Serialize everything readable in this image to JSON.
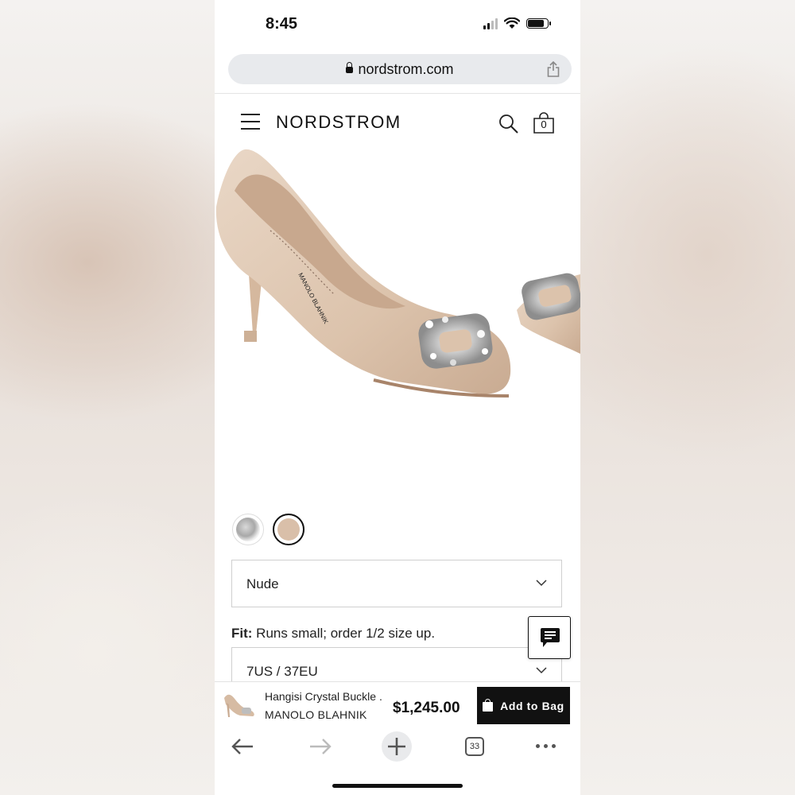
{
  "status_bar": {
    "time": "8:45",
    "icons": [
      "signal-icon",
      "wifi-icon",
      "battery-icon"
    ]
  },
  "browser": {
    "url": "nordstrom.com",
    "tabs_count": "33",
    "icons": [
      "lock-icon",
      "share-icon",
      "back-arrow-icon",
      "forward-arrow-icon",
      "plus-icon",
      "tabs-icon",
      "more-icon"
    ]
  },
  "header": {
    "brand": "NORDSTROM",
    "bag_count": "0",
    "icons": [
      "hamburger-menu-icon",
      "search-icon",
      "shopping-bag-icon"
    ]
  },
  "product": {
    "image": "nude-pump-with-crystal-buckle-image",
    "swatches": [
      "crystal-swatch",
      "nude-swatch"
    ],
    "selected_swatch": "nude-swatch",
    "color_select": "Nude",
    "fit_label": "Fit:",
    "fit_text": "Runs small; order 1/2 size up.",
    "size_select": "7US / 37EU"
  },
  "sticky_bar": {
    "title": "Hangisi Crystal Buckle ...",
    "brand": "MANOLO BLAHNIK",
    "price": "$1,245.00",
    "add_button": "Add to Bag"
  },
  "colors": {
    "accent": "#111111",
    "leather": "#dcc3ac",
    "address_bar_bg": "#e8eaed"
  }
}
